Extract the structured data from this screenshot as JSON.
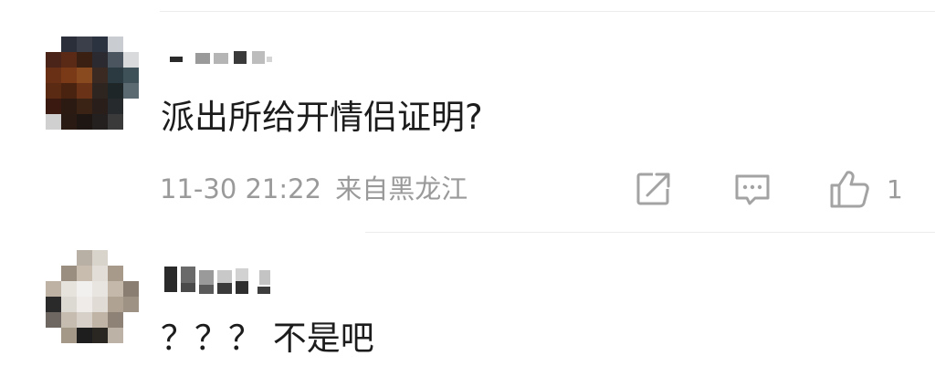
{
  "comments": [
    {
      "text": "派出所给开情侣证明?",
      "time": "11-30 21:22",
      "location": "来自黑龙江",
      "like_count": "1",
      "actions": [
        "share-icon",
        "reply-icon",
        "like-icon"
      ]
    },
    {
      "text": "？？？ 不是吧"
    }
  ],
  "colors": {
    "text": "#1c1c1c",
    "meta": "#9a9a9a",
    "divider": "#ececec",
    "icon": "#a3a3a3"
  }
}
